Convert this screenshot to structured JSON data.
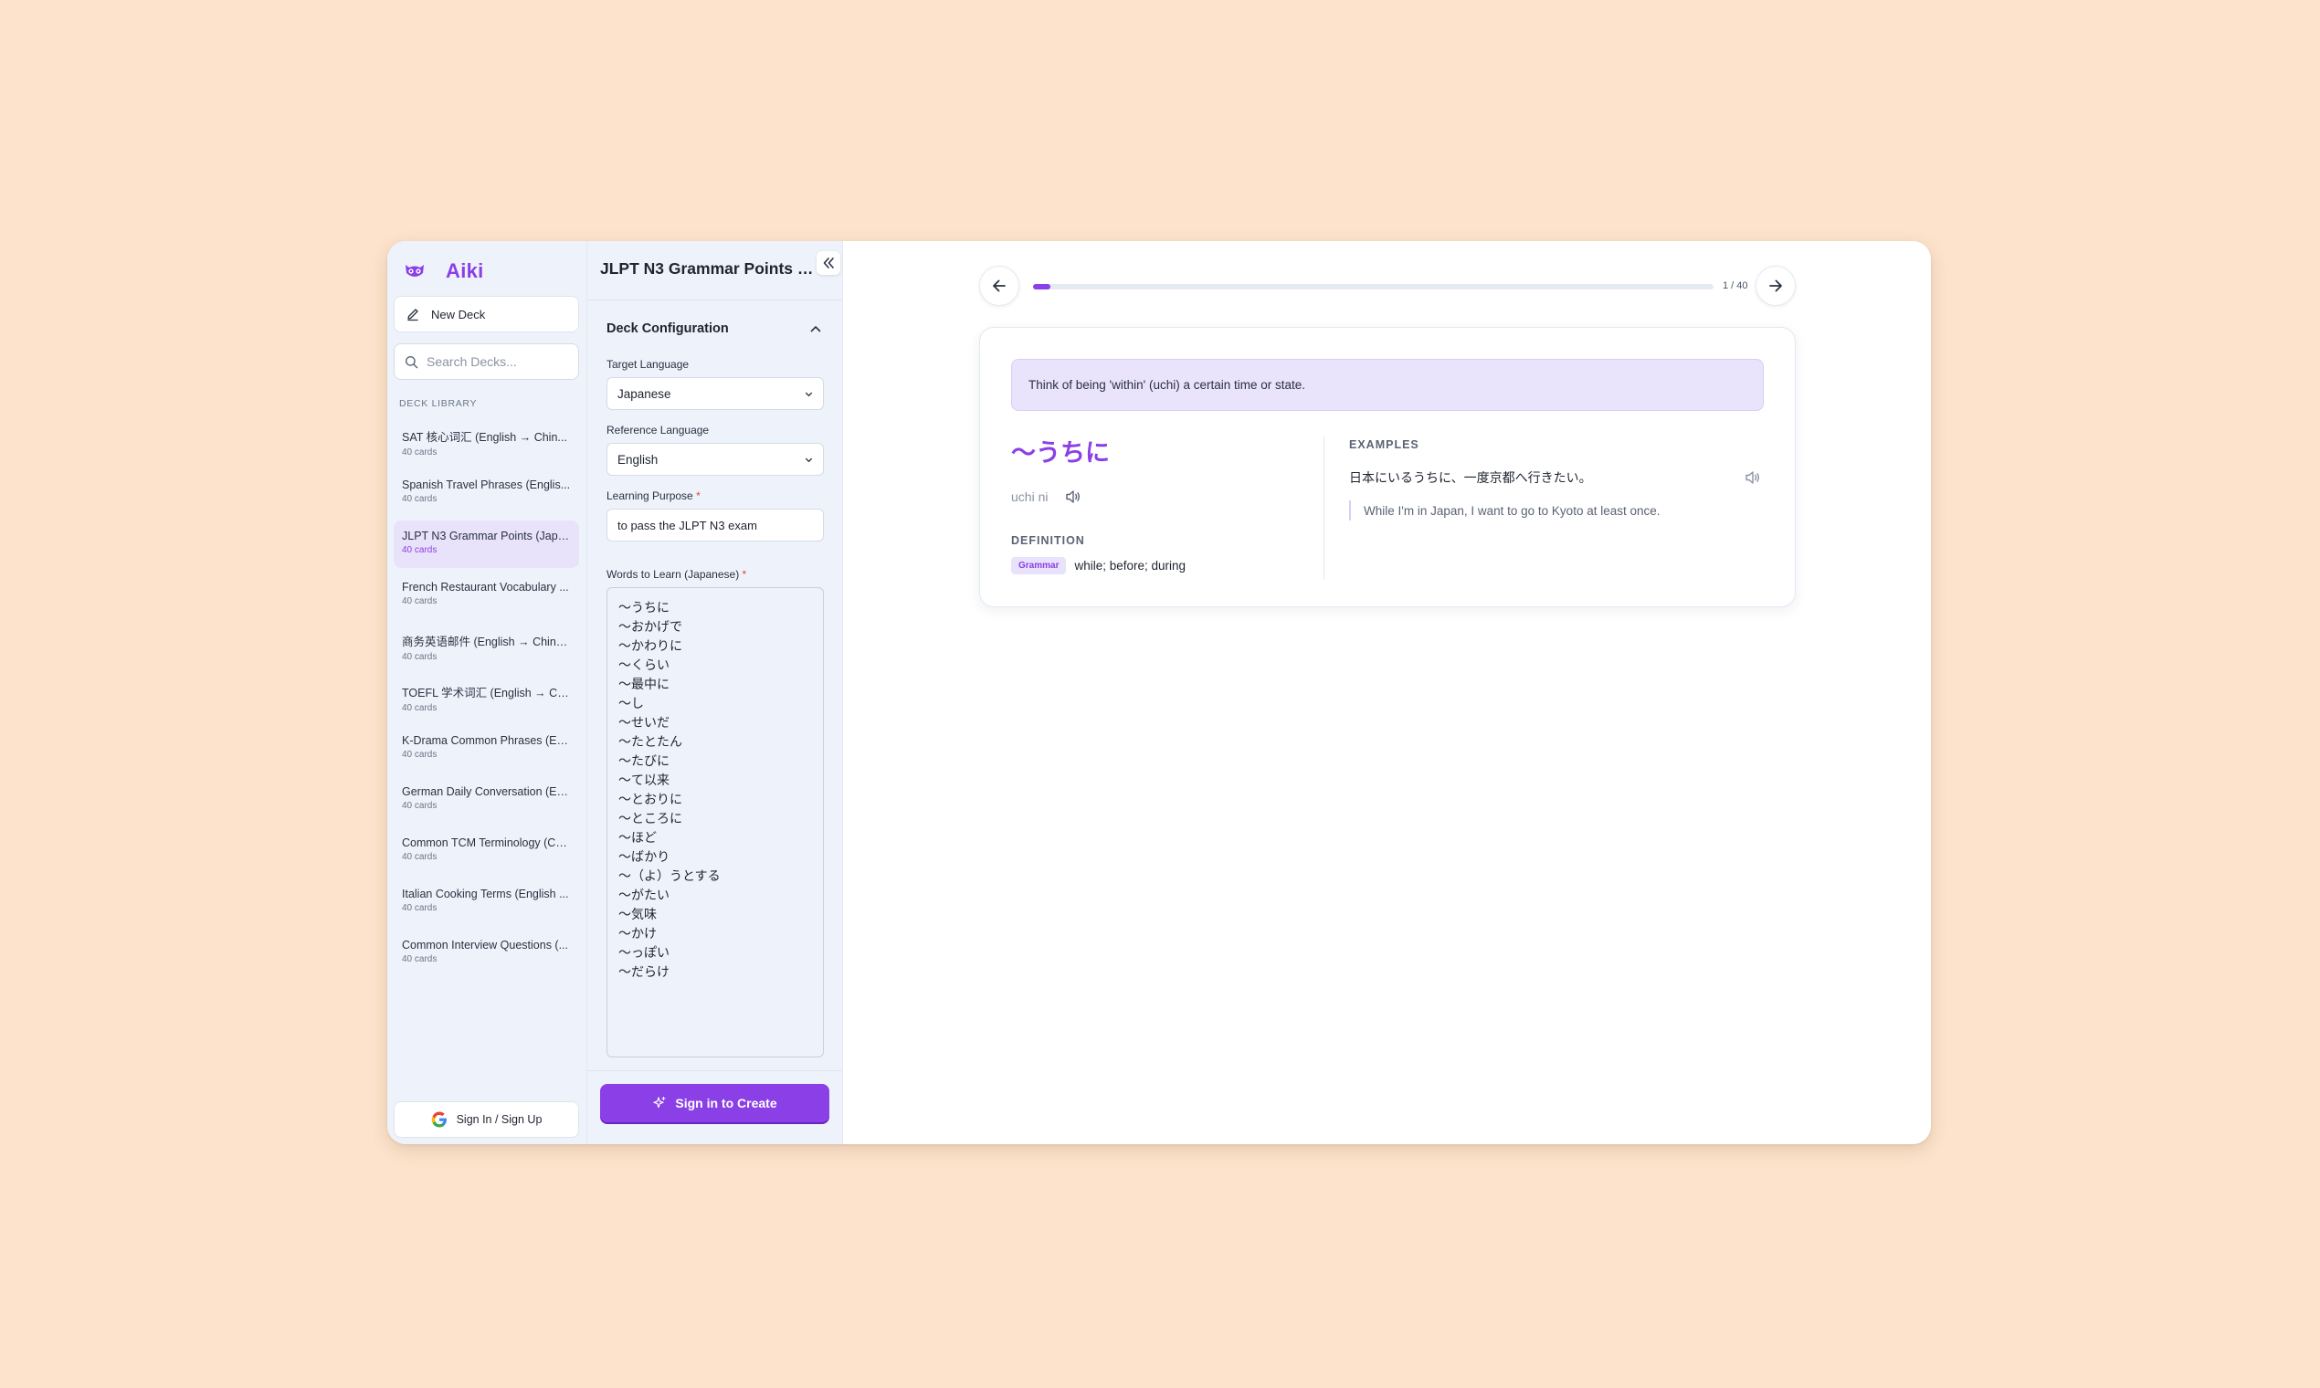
{
  "app": {
    "name": "Aiki"
  },
  "sidebar": {
    "new_deck_label": "New Deck",
    "search_placeholder": "Search Decks...",
    "library_label": "DECK LIBRARY",
    "decks": [
      {
        "name": "SAT 核心词汇 (English → Chin...",
        "count": "40 cards"
      },
      {
        "name": "Spanish Travel Phrases (Englis...",
        "count": "40 cards"
      },
      {
        "name": "JLPT N3 Grammar Points (Japa...",
        "count": "40 cards"
      },
      {
        "name": "French Restaurant Vocabulary ...",
        "count": "40 cards"
      },
      {
        "name": "商务英语邮件 (English → Chine...",
        "count": "40 cards"
      },
      {
        "name": "TOEFL 学术词汇 (English → Ch...",
        "count": "40 cards"
      },
      {
        "name": "K-Drama Common Phrases (En...",
        "count": "40 cards"
      },
      {
        "name": "German Daily Conversation (En...",
        "count": "40 cards"
      },
      {
        "name": "Common TCM Terminology (Ch...",
        "count": "40 cards"
      },
      {
        "name": "Italian Cooking Terms (English ...",
        "count": "40 cards"
      },
      {
        "name": "Common Interview Questions (...",
        "count": "40 cards"
      }
    ],
    "active_index": 2,
    "signin_label": "Sign In / Sign Up"
  },
  "config": {
    "title": "JLPT N3 Grammar Points (Ja...",
    "section_title": "Deck Configuration",
    "target_language_label": "Target Language",
    "target_language": "Japanese",
    "reference_language_label": "Reference Language",
    "reference_language": "English",
    "purpose_label": "Learning Purpose",
    "purpose_value": "to pass the JLPT N3 exam",
    "words_label": "Words to Learn (Japanese)",
    "required_mark": "*",
    "words": [
      "～うちに",
      "～おかげで",
      "～かわりに",
      "～くらい",
      "～最中に",
      "～し",
      "～せいだ",
      "～たとたん",
      "～たびに",
      "～て以来",
      "～とおりに",
      "～ところに",
      "～ほど",
      "～ばかり",
      "～（よ）うとする",
      "～がたい",
      "～気味",
      "～かけ",
      "～っぽい",
      "～だらけ"
    ],
    "create_label": "Sign in to Create"
  },
  "viewer": {
    "progress_label": "1 / 40",
    "progress_fraction": 0.025,
    "card": {
      "hint": "Think of being 'within' (uchi) a certain time or state.",
      "term": "～うちに",
      "reading": "uchi ni",
      "definition_label": "DEFINITION",
      "part_of_speech": "Grammar",
      "definition": "while; before; during",
      "examples_label": "EXAMPLES",
      "example_jp": "日本にいるうちに、一度京都へ行きたい。",
      "example_en": "While I'm in Japan, I want to go to Kyoto at least once."
    }
  },
  "colors": {
    "accent": "#8B3FE6",
    "background": "#FDE3CC",
    "panel": "#EEF3FB"
  }
}
